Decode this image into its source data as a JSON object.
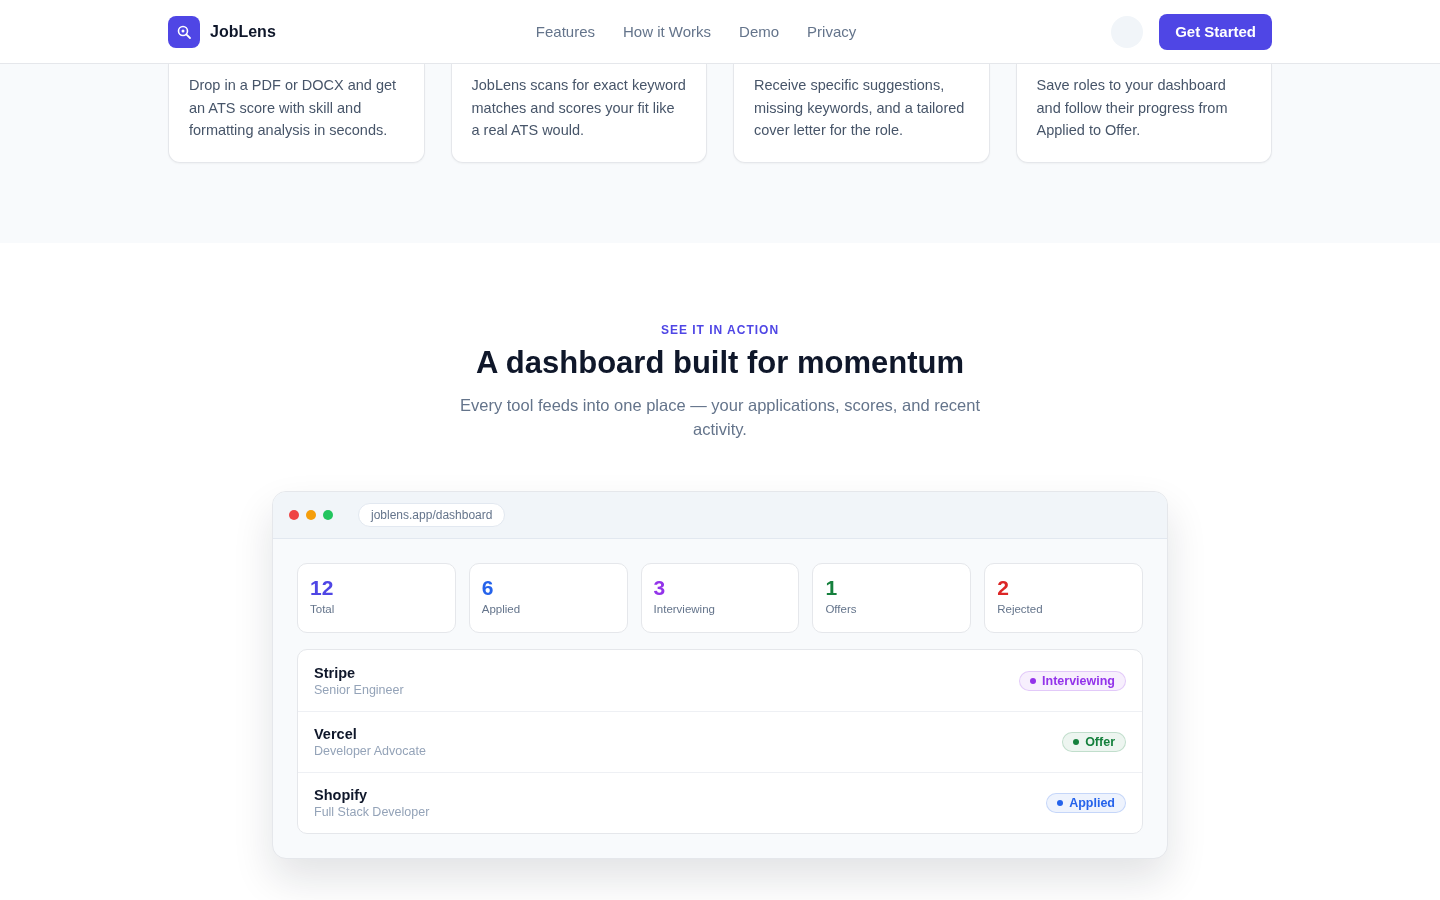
{
  "nav": {
    "brand": "JobLens",
    "links": [
      "Features",
      "How it Works",
      "Demo",
      "Privacy"
    ],
    "cta": "Get Started"
  },
  "feature_cards": [
    {
      "text": "Drop in a PDF or DOCX and get an ATS score with skill and formatting analysis in seconds."
    },
    {
      "text": "JobLens scans for exact keyword matches and scores your fit like a real ATS would."
    },
    {
      "text": "Receive specific suggestions, missing keywords, and a tailored cover letter for the role."
    },
    {
      "text": "Save roles to your dashboard and follow their progress from Applied to Offer."
    }
  ],
  "demo": {
    "eyebrow": "SEE IT IN ACTION",
    "title": "A dashboard built for momentum",
    "subtitle": "Every tool feeds into one place — your applications, scores, and recent activity.",
    "url": "joblens.app/dashboard",
    "stats": [
      {
        "value": "12",
        "label": "Total",
        "color": "#4f46e5"
      },
      {
        "value": "6",
        "label": "Applied",
        "color": "#2563eb"
      },
      {
        "value": "3",
        "label": "Interviewing",
        "color": "#9333ea"
      },
      {
        "value": "1",
        "label": "Offers",
        "color": "#15803d"
      },
      {
        "value": "2",
        "label": "Rejected",
        "color": "#dc2626"
      }
    ],
    "applications": [
      {
        "company": "Stripe",
        "role": "Senior Engineer",
        "status": "Interviewing",
        "color": "#9333ea"
      },
      {
        "company": "Vercel",
        "role": "Developer Advocate",
        "status": "Offer",
        "color": "#15803d"
      },
      {
        "company": "Shopify",
        "role": "Full Stack Developer",
        "status": "Applied",
        "color": "#2563eb"
      }
    ]
  }
}
